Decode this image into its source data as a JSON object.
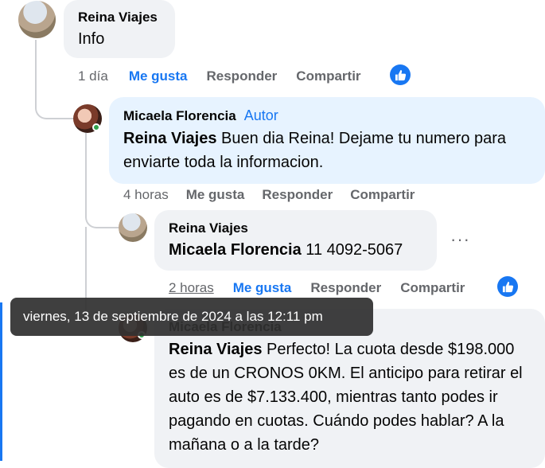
{
  "comment1": {
    "author": "Reina Viajes",
    "text": "Info",
    "time": "1 día",
    "actions": [
      "Me gusta",
      "Responder",
      "Compartir"
    ]
  },
  "comment2": {
    "author": "Micaela Florencia",
    "badge": "Autor",
    "mention": "Reina Viajes",
    "text": " Buen dia Reina! Dejame tu numero para enviarte toda la informacion.",
    "time": "4 horas",
    "actions": [
      "Me gusta",
      "Responder",
      "Compartir"
    ]
  },
  "comment3": {
    "author": "Reina Viajes",
    "mention": "Micaela Florencia",
    "text": " 11 4092-5067",
    "time": "2 horas",
    "actions": [
      "Me gusta",
      "Responder",
      "Compartir"
    ],
    "more": "···"
  },
  "comment4": {
    "author": "Micaela Florencia",
    "mention": "Reina Viajes",
    "text": " Perfecto! La cuota desde $198.000 es de un CRONOS 0KM. El anticipo para retirar el auto es de $7.133.400, mientras tanto podes ir pagando en cuotas. Cuándo podes hablar? A la mañana o a la tarde?"
  },
  "tooltip": {
    "text": "viernes, 13 de septiembre de 2024 a las 12:11 pm"
  },
  "colors": {
    "accent": "#1877f2",
    "bubble": "#f0f2f5",
    "author_bubble": "#e7f3ff",
    "secondary_text": "#65676b",
    "online": "#31a24c"
  }
}
